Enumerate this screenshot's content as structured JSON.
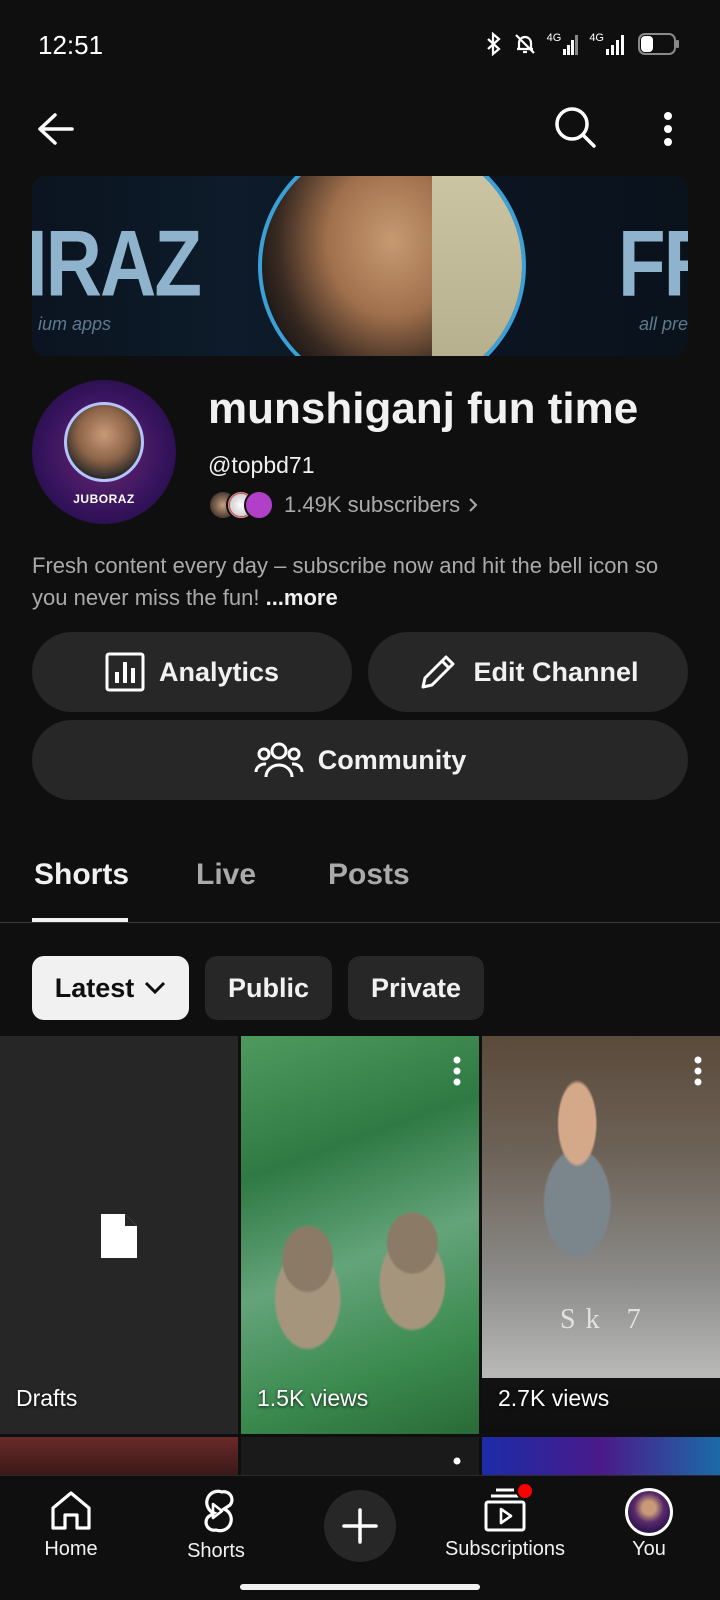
{
  "status_bar": {
    "time": "12:51",
    "net1": "4G",
    "net2": "4G"
  },
  "channel": {
    "banner_left_text": "IRAZ",
    "banner_left_sub": "ium apps",
    "banner_right_text": "FR",
    "banner_right_sub": "all pre",
    "avatar_label": "JUBORAZ",
    "name": "munshiganj fun time",
    "handle": "@topbd71",
    "subscribers": "1.49K subscribers",
    "description": "Fresh content every day – subscribe now and hit the bell icon so you never miss the fun!",
    "more": "...more"
  },
  "actions": {
    "analytics": "Analytics",
    "edit_channel": "Edit Channel",
    "community": "Community"
  },
  "tabs": [
    {
      "label": "Shorts",
      "active": true
    },
    {
      "label": "Live",
      "active": false
    },
    {
      "label": "Posts",
      "active": false
    }
  ],
  "filters": {
    "latest": "Latest",
    "public": "Public",
    "private": "Private"
  },
  "grid": {
    "drafts": "Drafts",
    "tile2_views": "1.5K views",
    "tile3_views": "2.7K views",
    "tile3_watermark": "Sk 7"
  },
  "bottom_nav": {
    "home": "Home",
    "shorts": "Shorts",
    "subscriptions": "Subscriptions",
    "you": "You"
  },
  "colors": {
    "background": "#0f0f0f",
    "surface": "#272727",
    "notification": "#ff0000"
  }
}
